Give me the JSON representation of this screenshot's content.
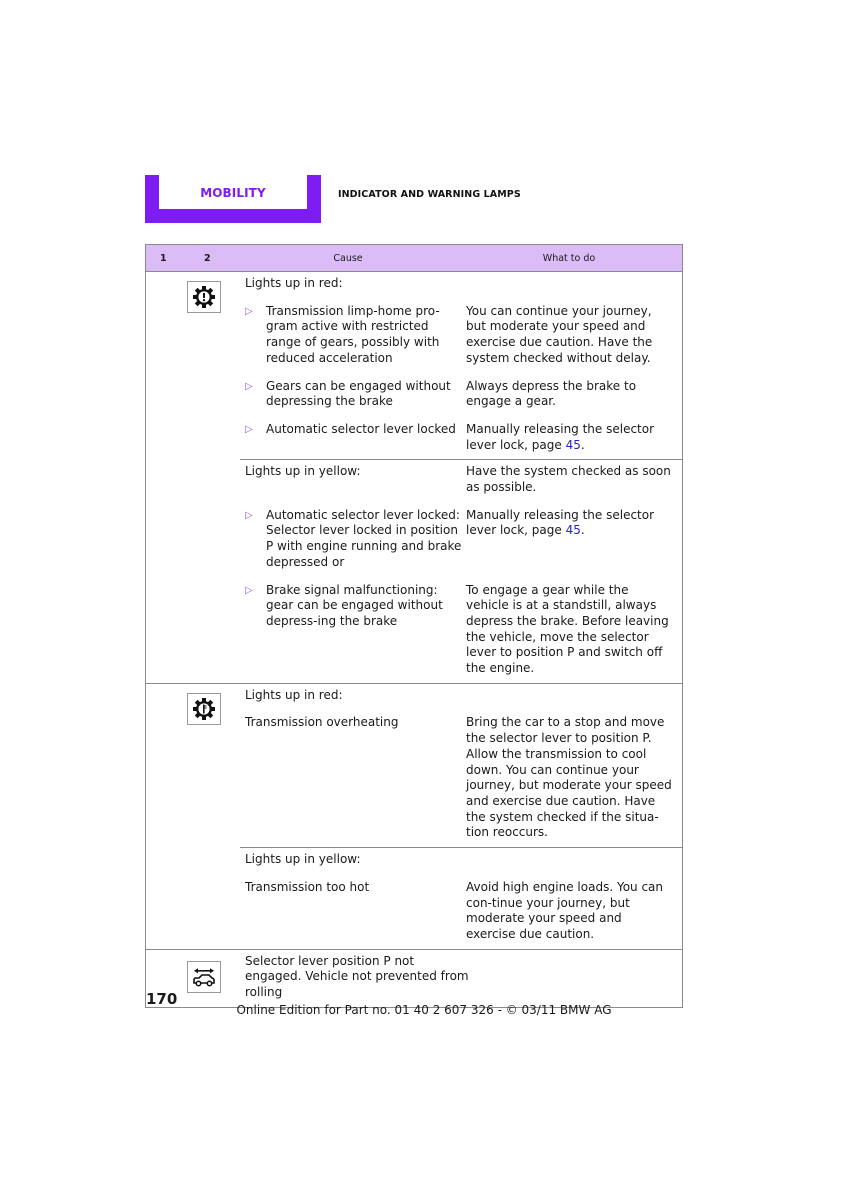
{
  "header": {
    "tab_label": "MOBILITY",
    "section_title": "INDICATOR AND WARNING LAMPS",
    "accent_color": "#7f1cf6"
  },
  "table": {
    "columns": [
      "1",
      "2",
      "Cause",
      "What to do"
    ],
    "header_bg": "#dbbcf7",
    "groups": [
      {
        "icon": "transmission-warning-gear-exclamation-icon",
        "subsections": [
          {
            "title": "Lights up in red:",
            "title_todo": "",
            "rows": [
              {
                "bullet": true,
                "cause": "Transmission limp-home pro-gram active with restricted range of gears, possibly with reduced acceleration",
                "todo": "You can continue your journey, but moderate your speed and exercise due caution. Have the system checked without delay.",
                "todo_link": ""
              },
              {
                "bullet": true,
                "cause": "Gears can be engaged without depressing the brake",
                "todo": "Always depress the brake to engage a gear.",
                "todo_link": ""
              },
              {
                "bullet": true,
                "cause": "Automatic selector lever locked",
                "todo": "Manually releasing the selector lever lock, page ",
                "todo_link": "45"
              }
            ]
          },
          {
            "title": "Lights up in yellow:",
            "title_todo": "Have the system checked as soon as possible.",
            "rows": [
              {
                "bullet": true,
                "cause": "Automatic selector lever locked: Selector lever locked in position P with engine running and brake depressed or",
                "todo": "Manually releasing the selector lever lock, page ",
                "todo_link": "45"
              },
              {
                "bullet": true,
                "cause": "Brake signal malfunctioning: gear can be engaged without depress-ing the brake",
                "todo": "To engage a gear while the vehicle is at a standstill, always depress the brake. Before leaving the vehicle, move the selector lever to position P and switch off the engine.",
                "todo_link": ""
              }
            ]
          }
        ]
      },
      {
        "icon": "transmission-temperature-gear-thermometer-icon",
        "subsections": [
          {
            "title": "Lights up in red:",
            "title_todo": "",
            "rows": [
              {
                "bullet": false,
                "cause": "Transmission overheating",
                "todo": "Bring the car to a stop and move the selector lever to position P. Allow the transmission to cool down. You can continue your journey, but moderate your speed and exercise due caution. Have the system checked if the situa-tion reoccurs.",
                "todo_link": ""
              }
            ]
          },
          {
            "title": "Lights up in yellow:",
            "title_todo": "",
            "rows": [
              {
                "bullet": false,
                "cause": "Transmission too hot",
                "todo": "Avoid high engine loads. You can con-tinue your journey, but moderate your speed and exercise due caution.",
                "todo_link": ""
              }
            ]
          }
        ]
      },
      {
        "icon": "vehicle-rolling-car-arrow-icon",
        "subsections": [
          {
            "title": "Selector lever position P not engaged. Vehicle not prevented from rolling",
            "title_todo": "",
            "rows": []
          }
        ]
      }
    ]
  },
  "footer": {
    "page_number": "170",
    "edition_text": "Online Edition for Part no. 01 40 2 607 326 - © 03/11 BMW AG"
  }
}
